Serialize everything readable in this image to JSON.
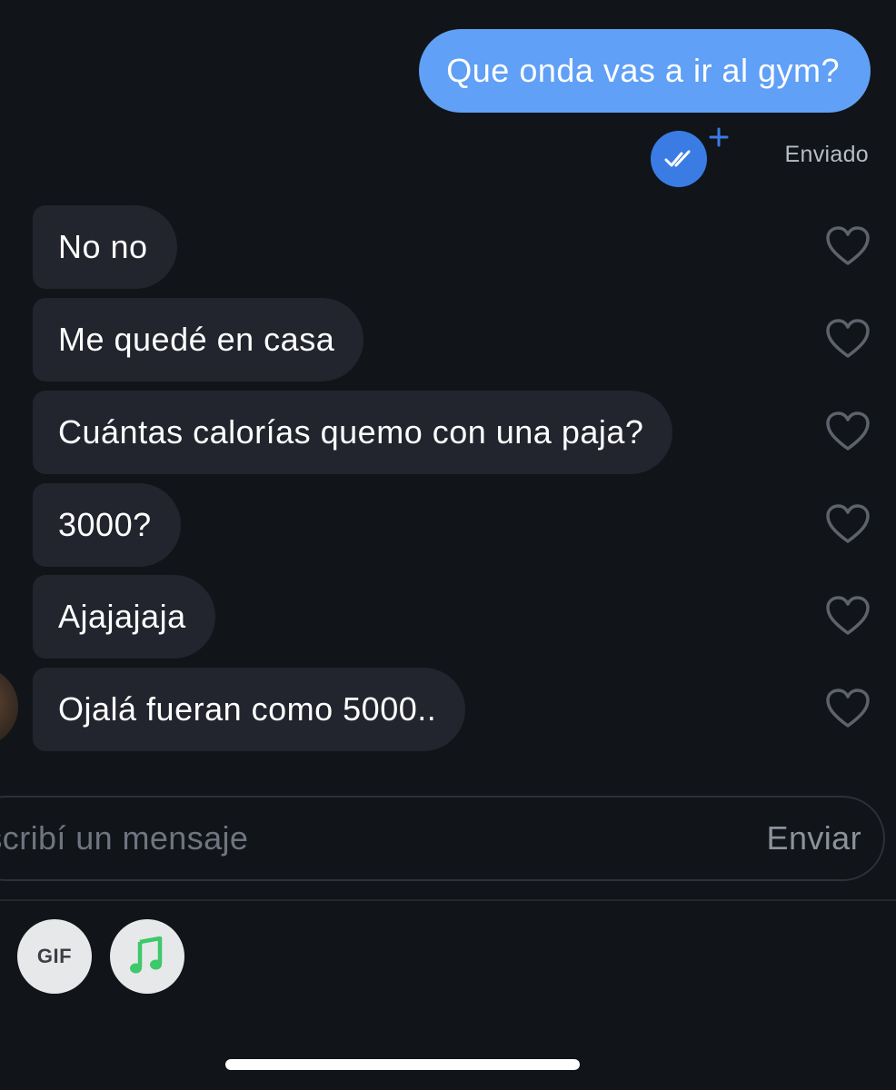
{
  "thread": {
    "sent": [
      {
        "text": "Que onda vas a ir al gym?"
      }
    ],
    "status": {
      "label": "Enviado",
      "read_icon": "double-check-icon",
      "badge_icon": "plus-icon"
    },
    "received": [
      {
        "text": "No no"
      },
      {
        "text": "Me quedé en casa"
      },
      {
        "text": "Cuántas calorías quemo con una paja?"
      },
      {
        "text": "3000?"
      },
      {
        "text": "Ajajajaja"
      },
      {
        "text": "Ojalá fueran como 5000.."
      }
    ]
  },
  "composer": {
    "placeholder": "Escribí un mensaje",
    "send_label": "Enviar"
  },
  "toolbar": {
    "gif_label": "GIF",
    "music_icon": "music-note-icon"
  },
  "colors": {
    "background": "#111418",
    "sent_bubble": "#60a0f6",
    "received_bubble": "#22252d",
    "read_badge": "#3a7ce4",
    "music_icon": "#3ec86a"
  }
}
